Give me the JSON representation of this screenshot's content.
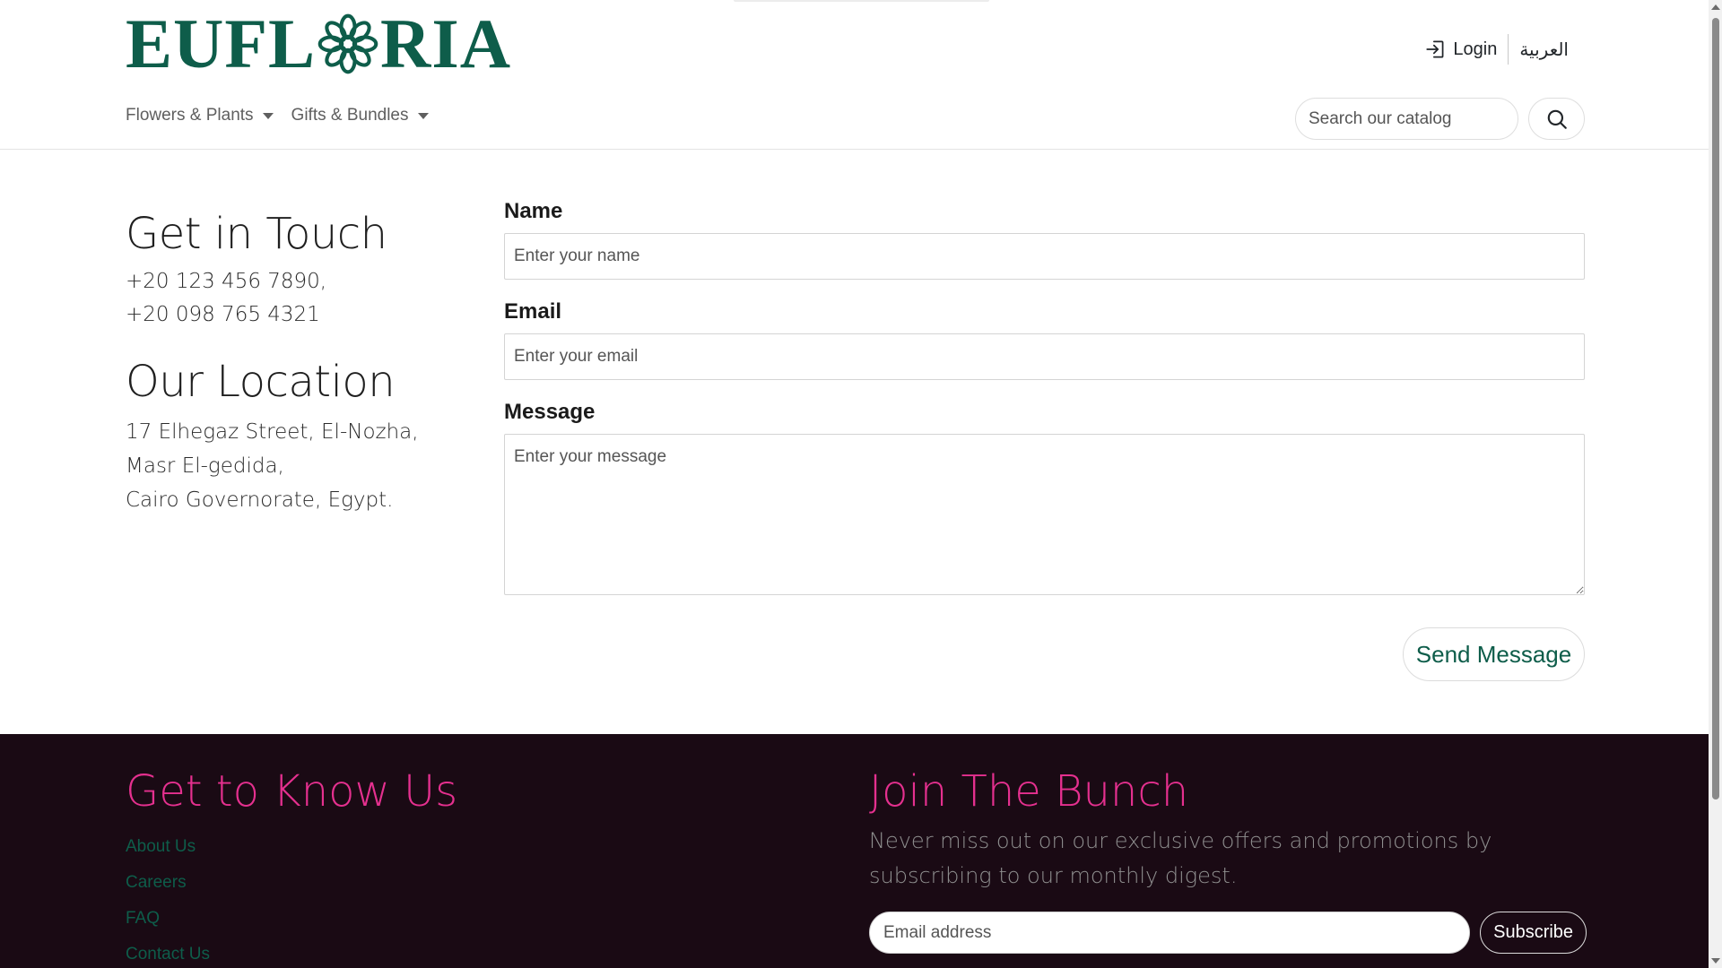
{
  "brand": {
    "left": "EUFL",
    "right": "RIA",
    "color": "#0e5d4a"
  },
  "header": {
    "login_label": "Login",
    "language_label": "العربية",
    "nav": [
      {
        "label": "Flowers & Plants"
      },
      {
        "label": "Gifts & Bundles"
      }
    ],
    "search": {
      "placeholder": "Search our catalog"
    }
  },
  "contact": {
    "title": "Get in Touch",
    "phones": [
      "+20 123 456 7890,",
      "+20 098 765 4321"
    ],
    "location_title": "Our Location",
    "address": [
      "17 Elhegaz Street, El-Nozha,",
      "Masr El-gedida,",
      "Cairo Governorate, Egypt."
    ]
  },
  "form": {
    "name_label": "Name",
    "name_placeholder": "Enter your name",
    "email_label": "Email",
    "email_placeholder": "Enter your email",
    "message_label": "Message",
    "message_placeholder": "Enter your message",
    "submit_label": "Send Message"
  },
  "footer": {
    "about_title": "Get to Know Us",
    "links": [
      "About Us",
      "Careers",
      "FAQ",
      "Contact Us"
    ],
    "newsletter_title": "Join The Bunch",
    "newsletter_text": "Never miss out on our exclusive offers and promotions by subscribing to our monthly digest.",
    "email_placeholder": "Email address",
    "subscribe_label": "Subscribe",
    "accent_color": "#e5308f",
    "background_color": "#1a0a14"
  }
}
